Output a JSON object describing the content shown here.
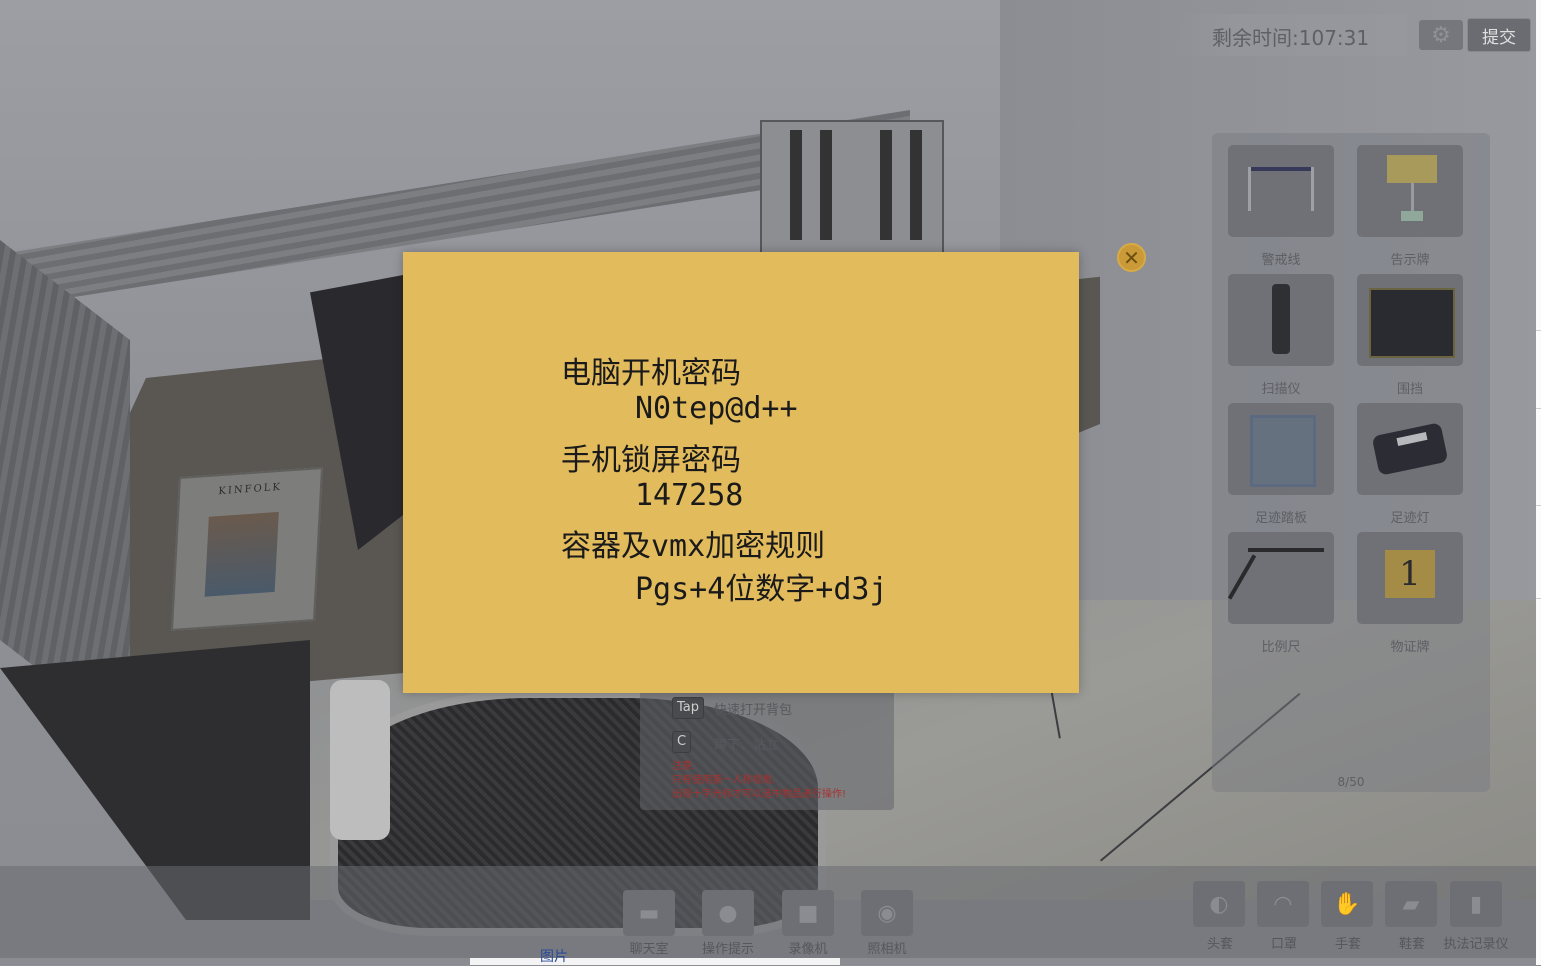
{
  "hud": {
    "timer_label": "剩余时间:",
    "timer_value": "107:31",
    "settings_icon": "gear-icon",
    "submit_label": "提交"
  },
  "tools": {
    "items": [
      {
        "label": "警戒线",
        "icon": "barrier-tape-icon"
      },
      {
        "label": "告示牌",
        "icon": "notice-sign-icon"
      },
      {
        "label": "扫描仪",
        "icon": "scanner-icon"
      },
      {
        "label": "围挡",
        "icon": "enclosure-icon"
      },
      {
        "label": "足迹踏板",
        "icon": "footprint-plate-icon"
      },
      {
        "label": "足迹灯",
        "icon": "footprint-lamp-icon"
      },
      {
        "label": "比例尺",
        "icon": "scale-ruler-icon"
      },
      {
        "label": "物证牌",
        "icon": "evidence-marker-icon",
        "marker_text": "1"
      }
    ],
    "count": "8/50"
  },
  "hints": {
    "tap_key": "Tap",
    "tap_text": "快速打开背包",
    "c_key": "C",
    "c_text": "蹲下、站立",
    "warn_title": "注意:",
    "warn_line1": "只有使用第一人称视角,",
    "warn_line2": "出现十字光标才可以选中物品进行操作!"
  },
  "note": {
    "line1": "电脑开机密码",
    "line2": "N0tep@d++",
    "line3": "手机锁屏密码",
    "line4": "147258",
    "line5": "容器及vmx加密规则",
    "line6": "Pgs+4位数字+d3j",
    "close_icon": "close-icon"
  },
  "bottom_left": [
    {
      "label": "聊天室",
      "icon": "chat-icon"
    },
    {
      "label": "操作提示",
      "icon": "info-icon"
    },
    {
      "label": "录像机",
      "icon": "video-camera-icon"
    },
    {
      "label": "照相机",
      "icon": "camera-icon"
    }
  ],
  "bottom_right": [
    {
      "label": "头套",
      "icon": "head-cover-icon"
    },
    {
      "label": "口罩",
      "icon": "mask-icon"
    },
    {
      "label": "手套",
      "icon": "glove-icon"
    },
    {
      "label": "鞋套",
      "icon": "shoe-cover-icon"
    },
    {
      "label": "执法记录仪",
      "icon": "body-camera-icon"
    }
  ],
  "scene": {
    "magazine_title": "KINFOLK"
  },
  "bottom_fragment": "图片"
}
